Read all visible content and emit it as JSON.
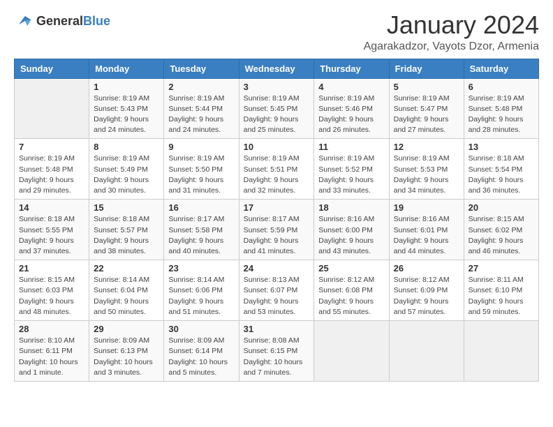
{
  "header": {
    "logo_general": "General",
    "logo_blue": "Blue",
    "month_year": "January 2024",
    "location": "Agarakadzor, Vayots Dzor, Armenia"
  },
  "weekdays": [
    "Sunday",
    "Monday",
    "Tuesday",
    "Wednesday",
    "Thursday",
    "Friday",
    "Saturday"
  ],
  "weeks": [
    [
      {
        "day": "",
        "sunrise": "",
        "sunset": "",
        "daylight": ""
      },
      {
        "day": "1",
        "sunrise": "Sunrise: 8:19 AM",
        "sunset": "Sunset: 5:43 PM",
        "daylight": "Daylight: 9 hours and 24 minutes."
      },
      {
        "day": "2",
        "sunrise": "Sunrise: 8:19 AM",
        "sunset": "Sunset: 5:44 PM",
        "daylight": "Daylight: 9 hours and 24 minutes."
      },
      {
        "day": "3",
        "sunrise": "Sunrise: 8:19 AM",
        "sunset": "Sunset: 5:45 PM",
        "daylight": "Daylight: 9 hours and 25 minutes."
      },
      {
        "day": "4",
        "sunrise": "Sunrise: 8:19 AM",
        "sunset": "Sunset: 5:46 PM",
        "daylight": "Daylight: 9 hours and 26 minutes."
      },
      {
        "day": "5",
        "sunrise": "Sunrise: 8:19 AM",
        "sunset": "Sunset: 5:47 PM",
        "daylight": "Daylight: 9 hours and 27 minutes."
      },
      {
        "day": "6",
        "sunrise": "Sunrise: 8:19 AM",
        "sunset": "Sunset: 5:48 PM",
        "daylight": "Daylight: 9 hours and 28 minutes."
      }
    ],
    [
      {
        "day": "7",
        "sunrise": "Sunrise: 8:19 AM",
        "sunset": "Sunset: 5:48 PM",
        "daylight": "Daylight: 9 hours and 29 minutes."
      },
      {
        "day": "8",
        "sunrise": "Sunrise: 8:19 AM",
        "sunset": "Sunset: 5:49 PM",
        "daylight": "Daylight: 9 hours and 30 minutes."
      },
      {
        "day": "9",
        "sunrise": "Sunrise: 8:19 AM",
        "sunset": "Sunset: 5:50 PM",
        "daylight": "Daylight: 9 hours and 31 minutes."
      },
      {
        "day": "10",
        "sunrise": "Sunrise: 8:19 AM",
        "sunset": "Sunset: 5:51 PM",
        "daylight": "Daylight: 9 hours and 32 minutes."
      },
      {
        "day": "11",
        "sunrise": "Sunrise: 8:19 AM",
        "sunset": "Sunset: 5:52 PM",
        "daylight": "Daylight: 9 hours and 33 minutes."
      },
      {
        "day": "12",
        "sunrise": "Sunrise: 8:19 AM",
        "sunset": "Sunset: 5:53 PM",
        "daylight": "Daylight: 9 hours and 34 minutes."
      },
      {
        "day": "13",
        "sunrise": "Sunrise: 8:18 AM",
        "sunset": "Sunset: 5:54 PM",
        "daylight": "Daylight: 9 hours and 36 minutes."
      }
    ],
    [
      {
        "day": "14",
        "sunrise": "Sunrise: 8:18 AM",
        "sunset": "Sunset: 5:55 PM",
        "daylight": "Daylight: 9 hours and 37 minutes."
      },
      {
        "day": "15",
        "sunrise": "Sunrise: 8:18 AM",
        "sunset": "Sunset: 5:57 PM",
        "daylight": "Daylight: 9 hours and 38 minutes."
      },
      {
        "day": "16",
        "sunrise": "Sunrise: 8:17 AM",
        "sunset": "Sunset: 5:58 PM",
        "daylight": "Daylight: 9 hours and 40 minutes."
      },
      {
        "day": "17",
        "sunrise": "Sunrise: 8:17 AM",
        "sunset": "Sunset: 5:59 PM",
        "daylight": "Daylight: 9 hours and 41 minutes."
      },
      {
        "day": "18",
        "sunrise": "Sunrise: 8:16 AM",
        "sunset": "Sunset: 6:00 PM",
        "daylight": "Daylight: 9 hours and 43 minutes."
      },
      {
        "day": "19",
        "sunrise": "Sunrise: 8:16 AM",
        "sunset": "Sunset: 6:01 PM",
        "daylight": "Daylight: 9 hours and 44 minutes."
      },
      {
        "day": "20",
        "sunrise": "Sunrise: 8:15 AM",
        "sunset": "Sunset: 6:02 PM",
        "daylight": "Daylight: 9 hours and 46 minutes."
      }
    ],
    [
      {
        "day": "21",
        "sunrise": "Sunrise: 8:15 AM",
        "sunset": "Sunset: 6:03 PM",
        "daylight": "Daylight: 9 hours and 48 minutes."
      },
      {
        "day": "22",
        "sunrise": "Sunrise: 8:14 AM",
        "sunset": "Sunset: 6:04 PM",
        "daylight": "Daylight: 9 hours and 50 minutes."
      },
      {
        "day": "23",
        "sunrise": "Sunrise: 8:14 AM",
        "sunset": "Sunset: 6:06 PM",
        "daylight": "Daylight: 9 hours and 51 minutes."
      },
      {
        "day": "24",
        "sunrise": "Sunrise: 8:13 AM",
        "sunset": "Sunset: 6:07 PM",
        "daylight": "Daylight: 9 hours and 53 minutes."
      },
      {
        "day": "25",
        "sunrise": "Sunrise: 8:12 AM",
        "sunset": "Sunset: 6:08 PM",
        "daylight": "Daylight: 9 hours and 55 minutes."
      },
      {
        "day": "26",
        "sunrise": "Sunrise: 8:12 AM",
        "sunset": "Sunset: 6:09 PM",
        "daylight": "Daylight: 9 hours and 57 minutes."
      },
      {
        "day": "27",
        "sunrise": "Sunrise: 8:11 AM",
        "sunset": "Sunset: 6:10 PM",
        "daylight": "Daylight: 9 hours and 59 minutes."
      }
    ],
    [
      {
        "day": "28",
        "sunrise": "Sunrise: 8:10 AM",
        "sunset": "Sunset: 6:11 PM",
        "daylight": "Daylight: 10 hours and 1 minute."
      },
      {
        "day": "29",
        "sunrise": "Sunrise: 8:09 AM",
        "sunset": "Sunset: 6:13 PM",
        "daylight": "Daylight: 10 hours and 3 minutes."
      },
      {
        "day": "30",
        "sunrise": "Sunrise: 8:09 AM",
        "sunset": "Sunset: 6:14 PM",
        "daylight": "Daylight: 10 hours and 5 minutes."
      },
      {
        "day": "31",
        "sunrise": "Sunrise: 8:08 AM",
        "sunset": "Sunset: 6:15 PM",
        "daylight": "Daylight: 10 hours and 7 minutes."
      },
      {
        "day": "",
        "sunrise": "",
        "sunset": "",
        "daylight": ""
      },
      {
        "day": "",
        "sunrise": "",
        "sunset": "",
        "daylight": ""
      },
      {
        "day": "",
        "sunrise": "",
        "sunset": "",
        "daylight": ""
      }
    ]
  ]
}
